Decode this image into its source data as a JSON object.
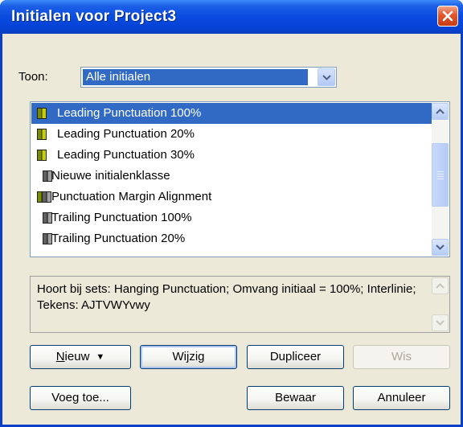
{
  "window": {
    "title": "Initialen voor Project3"
  },
  "filter": {
    "label": "Toon:",
    "selected": "Alle initialen"
  },
  "list": {
    "items": [
      {
        "label": "Leading Punctuation 100%",
        "icon": "yellow-class-icon",
        "selected": true
      },
      {
        "label": "Leading Punctuation 20%",
        "icon": "yellow-class-icon",
        "selected": false
      },
      {
        "label": "Leading Punctuation 30%",
        "icon": "yellow-class-icon",
        "selected": false
      },
      {
        "label": "Nieuwe initialenklasse",
        "icon": "gray-class-icon",
        "selected": false
      },
      {
        "label": "Punctuation Margin Alignment",
        "icon": "double-class-icon",
        "selected": false
      },
      {
        "label": "Trailing Punctuation 100%",
        "icon": "gray-class-icon",
        "selected": false
      },
      {
        "label": "Trailing Punctuation 20%",
        "icon": "gray-class-icon",
        "selected": false
      }
    ]
  },
  "info": {
    "text": "Hoort bij sets: Hanging Punctuation;   Omvang initiaal = 100%;   Interlinie;   Tekens: AJTVWYvwy"
  },
  "buttons": {
    "nieuw_prefix": "",
    "nieuw_underlined": "N",
    "nieuw_rest": "ieuw",
    "wijzig": "Wijzig",
    "dupliceer": "Dupliceer",
    "wis": "Wis",
    "voeg_toe": "Voeg toe...",
    "bewaar": "Bewaar",
    "annuleer": "Annuleer"
  },
  "colors": {
    "titlebar": "#0a4be0",
    "selection": "#316ac5",
    "dialog_bg": "#ece9d8"
  }
}
